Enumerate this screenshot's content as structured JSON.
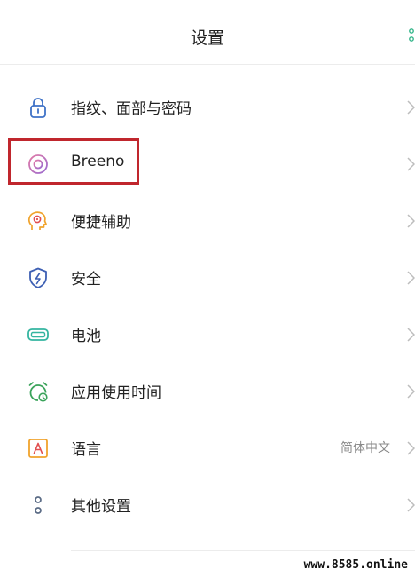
{
  "header": {
    "title": "设置",
    "more_icon": "more-dots-icon"
  },
  "rows": [
    {
      "label": "指纹、面部与密码",
      "icon": "lock-icon",
      "icon_color": "#3f72c7"
    },
    {
      "label": "Breeno",
      "icon": "breeno-icon",
      "icon_color": "#c869b8"
    },
    {
      "label": "便捷辅助",
      "icon": "head-gear-icon",
      "icon_color": "#f0a32c"
    },
    {
      "label": "安全",
      "icon": "shield-icon",
      "icon_color": "#3d5fb3"
    },
    {
      "label": "电池",
      "icon": "battery-icon",
      "icon_color": "#34b5a0"
    },
    {
      "label": "应用使用时间",
      "icon": "alarm-clock-icon",
      "icon_color": "#3aa35a"
    },
    {
      "label": "语言",
      "value": "简体中文",
      "icon": "language-a-icon",
      "icon_color": "#f0a32c"
    },
    {
      "label": "其他设置",
      "icon": "settings-dots-icon",
      "icon_color": "#5a6b85"
    }
  ],
  "highlight_color": "#c0262d",
  "watermark": "www.8585.online"
}
